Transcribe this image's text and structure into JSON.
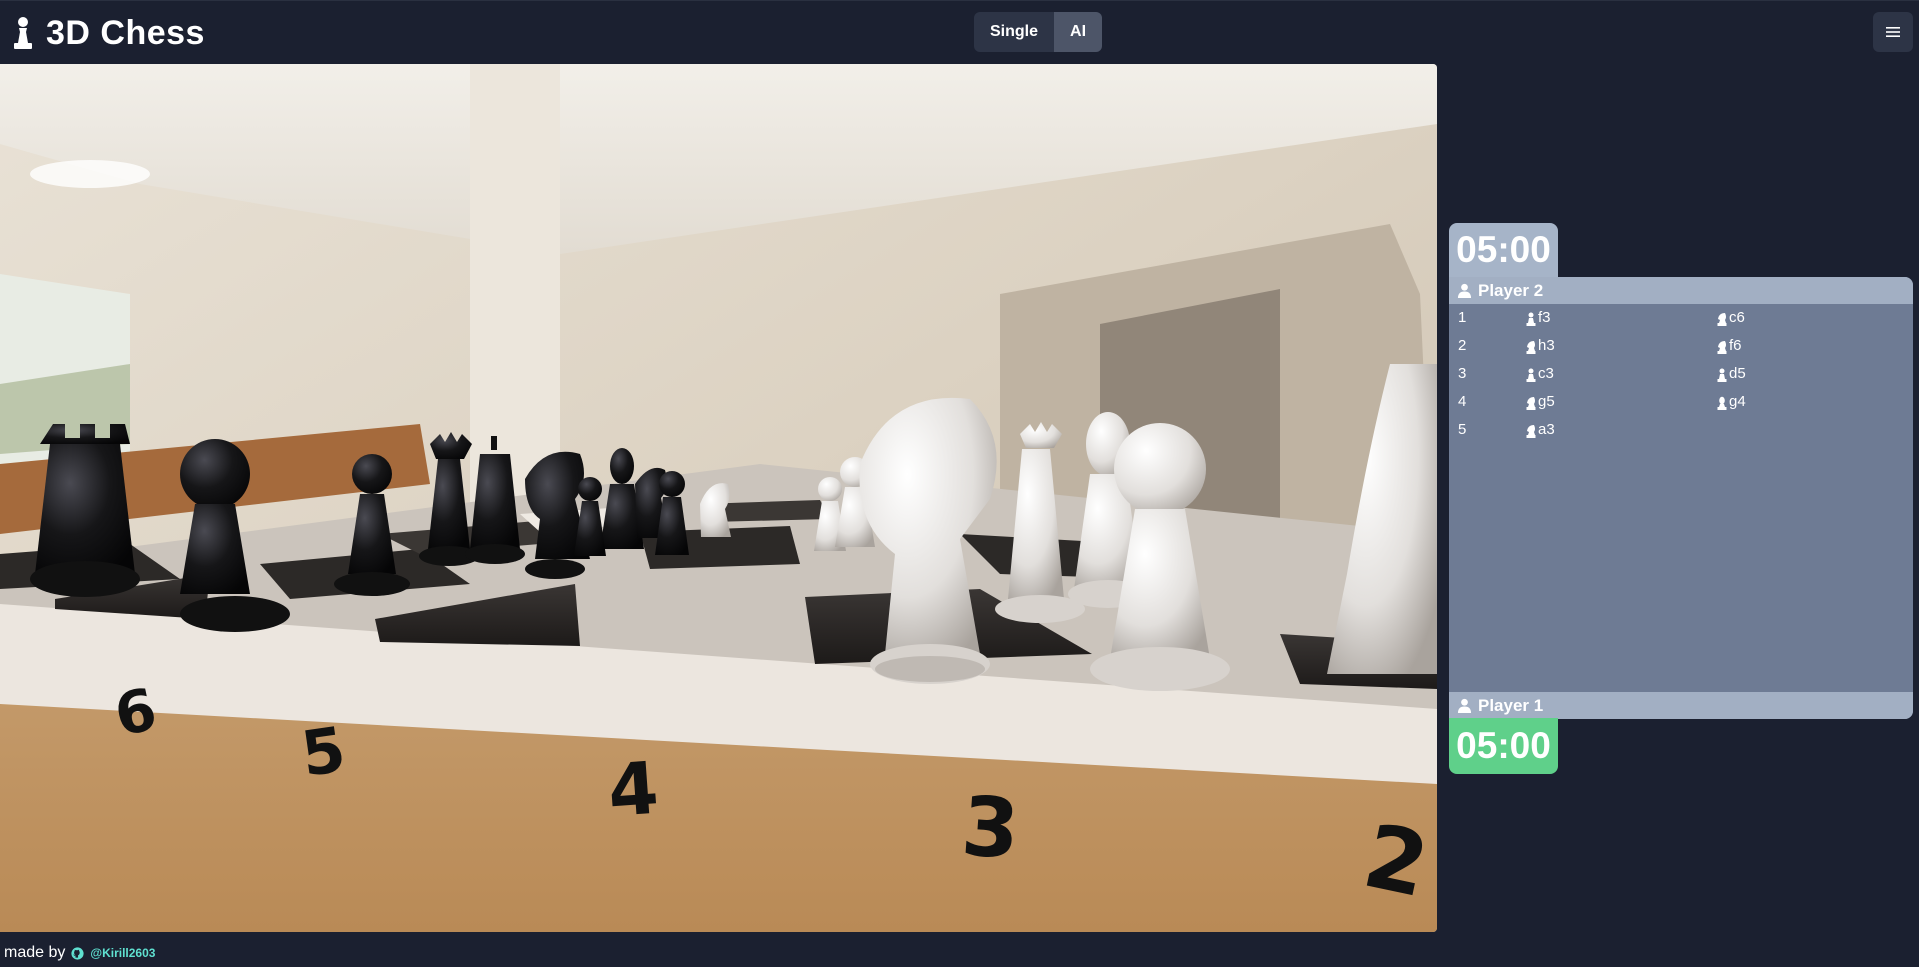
{
  "header": {
    "title": "3D Chess",
    "logo_icon": "pawn-icon",
    "modes": [
      {
        "label": "Single",
        "active": false
      },
      {
        "label": "AI",
        "active": true
      }
    ],
    "menu_icon": "hamburger-menu-icon"
  },
  "board": {
    "rank_labels": [
      "6",
      "5",
      "4",
      "3",
      "2"
    ]
  },
  "clocks": {
    "player2_time": "05:00",
    "player1_time": "05:00",
    "colors": {
      "inactive": "#a6b4c8",
      "active": "#5fd08a"
    }
  },
  "players": {
    "top": {
      "name": "Player 2",
      "icon": "user-icon"
    },
    "bottom": {
      "name": "Player 1",
      "icon": "user-icon"
    }
  },
  "moves": [
    {
      "num": "1",
      "white": {
        "piece": "pawn",
        "square": "f3"
      },
      "black": {
        "piece": "knight",
        "square": "c6"
      }
    },
    {
      "num": "2",
      "white": {
        "piece": "knight",
        "square": "h3"
      },
      "black": {
        "piece": "knight",
        "square": "f6"
      }
    },
    {
      "num": "3",
      "white": {
        "piece": "pawn",
        "square": "c3"
      },
      "black": {
        "piece": "pawn",
        "square": "d5"
      }
    },
    {
      "num": "4",
      "white": {
        "piece": "knight",
        "square": "g5"
      },
      "black": {
        "piece": "bishop",
        "square": "g4"
      }
    },
    {
      "num": "5",
      "white": {
        "piece": "knight",
        "square": "a3"
      },
      "black": null
    }
  ],
  "footer": {
    "made_by": "made by",
    "github_icon": "github-icon",
    "handle": "@Kirill2603"
  }
}
